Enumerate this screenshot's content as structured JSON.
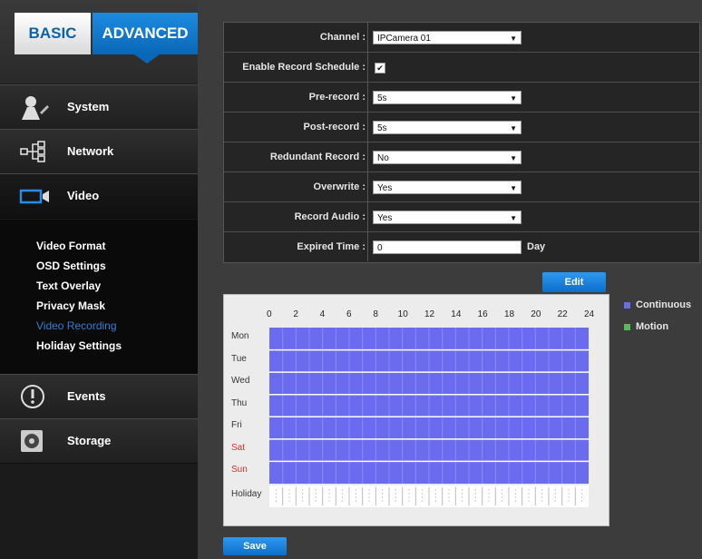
{
  "tabs": {
    "basic": "BASIC",
    "advanced": "ADVANCED"
  },
  "sidebar": {
    "sections": [
      {
        "label": "System",
        "icon": "system-icon"
      },
      {
        "label": "Network",
        "icon": "network-icon"
      },
      {
        "label": "Video",
        "icon": "video-camera-icon"
      },
      {
        "label": "Events",
        "icon": "alert-icon"
      },
      {
        "label": "Storage",
        "icon": "storage-icon"
      }
    ],
    "video_submenu": [
      {
        "label": "Video Format",
        "active": false
      },
      {
        "label": "OSD Settings",
        "active": false
      },
      {
        "label": "Text Overlay",
        "active": false
      },
      {
        "label": "Privacy Mask",
        "active": false
      },
      {
        "label": "Video Recording",
        "active": true
      },
      {
        "label": "Holiday Settings",
        "active": false
      }
    ]
  },
  "form": {
    "channel": {
      "label": "Channel :",
      "value": "IPCamera 01"
    },
    "enable_schedule": {
      "label": "Enable Record Schedule :",
      "checked": true
    },
    "pre_record": {
      "label": "Pre-record :",
      "value": "5s"
    },
    "post_record": {
      "label": "Post-record :",
      "value": "5s"
    },
    "redundant": {
      "label": "Redundant Record :",
      "value": "No"
    },
    "overwrite": {
      "label": "Overwrite :",
      "value": "Yes"
    },
    "record_audio": {
      "label": "Record Audio :",
      "value": "Yes"
    },
    "expired_time": {
      "label": "Expired Time :",
      "value": "0",
      "unit": "Day"
    }
  },
  "edit_label": "Edit",
  "save_label": "Save",
  "schedule": {
    "hours": [
      "0",
      "2",
      "4",
      "6",
      "8",
      "10",
      "12",
      "14",
      "16",
      "18",
      "20",
      "22",
      "24"
    ],
    "days": [
      {
        "label": "Mon",
        "weekend": false
      },
      {
        "label": "Tue",
        "weekend": false
      },
      {
        "label": "Wed",
        "weekend": false
      },
      {
        "label": "Thu",
        "weekend": false
      },
      {
        "label": "Fri",
        "weekend": false
      },
      {
        "label": "Sat",
        "weekend": true
      },
      {
        "label": "Sun",
        "weekend": true
      },
      {
        "label": "Holiday",
        "weekend": false
      }
    ]
  },
  "legend": [
    {
      "label": "Continuous",
      "color": "#6b6bf0"
    },
    {
      "label": "Motion",
      "color": "#5cb85c"
    }
  ],
  "colors": {
    "accent": "#0a67b8",
    "weekend": "#d83030",
    "continuous": "#6b6bf0"
  }
}
